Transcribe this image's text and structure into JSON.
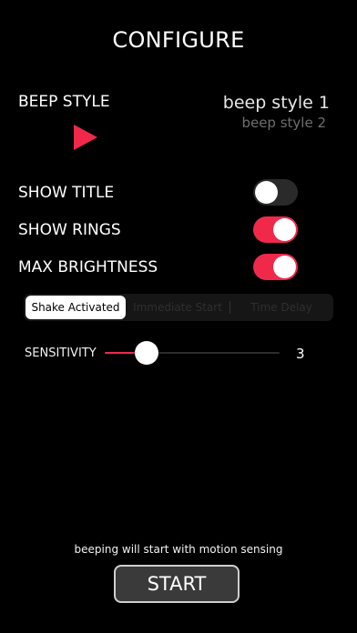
{
  "header": {
    "title": "CONFIGURE"
  },
  "beep": {
    "label": "BEEP STYLE",
    "play_icon": "play-icon",
    "options_visible": [
      "beep style 1",
      "beep style 2"
    ],
    "selected": "beep style 1"
  },
  "toggles": [
    {
      "label": "SHOW TITLE",
      "on": false
    },
    {
      "label": "SHOW RINGS",
      "on": true
    },
    {
      "label": "MAX BRIGHTNESS",
      "on": true
    }
  ],
  "mode": {
    "segments": [
      "Shake Activated",
      "Immediate Start",
      "Time Delay"
    ],
    "selected_index": 0
  },
  "sensitivity": {
    "label": "SENSITIVITY",
    "value": "3",
    "fill_fraction": 0.24
  },
  "footer": {
    "status_text": "beeping will start with motion sensing",
    "start_label": "START"
  },
  "colors": {
    "background": "#000000",
    "accent": "#f0294b",
    "toggle_off": "#2a2a2a"
  }
}
